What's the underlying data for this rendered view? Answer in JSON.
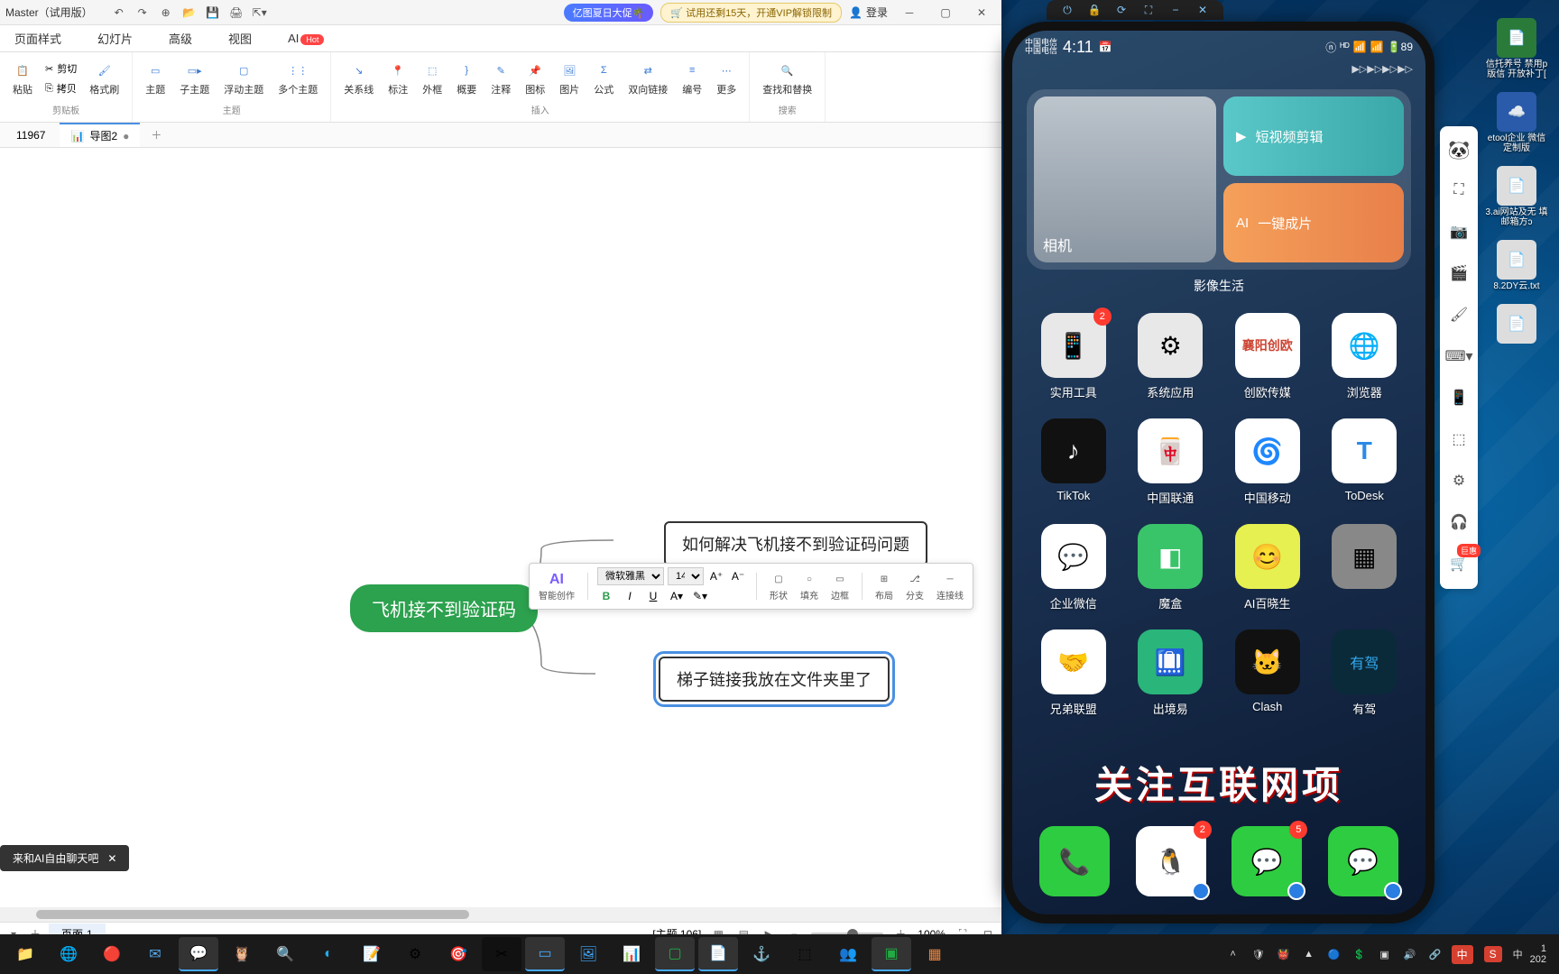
{
  "app": {
    "title": "Master（试用版）",
    "promo": "亿图夏日大促🌴",
    "trial": "🛒 试用还剩15天，开通VIP解锁限制",
    "login": "登录"
  },
  "menu": [
    "页面样式",
    "幻灯片",
    "高级",
    "视图",
    "AI"
  ],
  "ribbon": {
    "clip": {
      "paste": "粘贴",
      "cut": "剪切",
      "copy": "拷贝",
      "format": "格式刷",
      "label": "剪贴板"
    },
    "theme": {
      "theme": "主题",
      "sub": "子主题",
      "float": "浮动主题",
      "multi": "多个主题",
      "label": "主题"
    },
    "insert": {
      "rel": "关系线",
      "mark": "标注",
      "outer": "外框",
      "summary": "概要",
      "anno": "注释",
      "icon": "图标",
      "pic": "图片",
      "formula": "公式",
      "bi": "双向链接",
      "number": "编号",
      "more": "更多",
      "label": "插入"
    },
    "find": {
      "find": "查找和替换",
      "label": "搜索"
    }
  },
  "doc_tabs": {
    "t1": "11967",
    "t2": "导图2"
  },
  "mindmap": {
    "root": "飞机接不到验证码",
    "child1": "如何解决飞机接不到验证码问题",
    "child2": "梯子链接我放在文件夹里了"
  },
  "float_tb": {
    "ai_label": "智能创作",
    "font_name": "微软雅黑",
    "font_size": "14",
    "shape": "形状",
    "fill": "填充",
    "border": "边框",
    "layout": "布局",
    "branch": "分支",
    "line": "连接线"
  },
  "ai_prompt": "来和AI自由聊天吧",
  "status": {
    "theme_count": "[主题 106]",
    "zoom": "100%"
  },
  "page_tab": "页面-1",
  "phone": {
    "carrier1": "中国电信",
    "carrier2": "中国电信",
    "time": "4:11",
    "battery": "89",
    "widget": {
      "camera": "相机",
      "edit": "短视频剪辑",
      "onekey": "一键成片",
      "caption": "影像生活"
    },
    "apps": [
      {
        "label": "实用工具",
        "color": "#f0f0f0",
        "badge": "2"
      },
      {
        "label": "系统应用",
        "color": "#f0f0f0"
      },
      {
        "label": "创欧传媒",
        "color": "#fff"
      },
      {
        "label": "浏览器",
        "color": "#fff"
      },
      {
        "label": "TikTok",
        "color": "#111"
      },
      {
        "label": "中国联通",
        "color": "#fff"
      },
      {
        "label": "中国移动",
        "color": "#fff"
      },
      {
        "label": "ToDesk",
        "color": "#fff"
      },
      {
        "label": "企业微信",
        "color": "#fff"
      },
      {
        "label": "魔盒",
        "color": "#3ac46a"
      },
      {
        "label": "AI百晓生",
        "color": "#e6f050"
      },
      {
        "label": "",
        "color": "#888"
      },
      {
        "label": "兄弟联盟",
        "color": "#fff"
      },
      {
        "label": "出境易",
        "color": "#2ab57a"
      },
      {
        "label": "Clash",
        "color": "#111"
      },
      {
        "label": "有驾",
        "color": "#0a2a3a"
      }
    ],
    "banner": "关注互联网项",
    "dock": [
      {
        "color": "#2ecc40",
        "badge": ""
      },
      {
        "color": "#fff",
        "badge": "2"
      },
      {
        "color": "#2ecc40",
        "badge": "5"
      },
      {
        "color": "#2ecc40",
        "badge": ""
      }
    ]
  },
  "side_tools_cart": "巨惠",
  "desktop_icons": [
    {
      "label": "信托养号 禁用p版信 开放补丁["
    },
    {
      "label": "etool企业 微信定制版"
    },
    {
      "label": "3.ai网站及无 填邮箱方ɔ"
    },
    {
      "label": "8.2DY云.txt"
    },
    {
      "label": ""
    }
  ],
  "taskbar": {
    "ime": "中",
    "time": "1",
    "date": "202"
  }
}
